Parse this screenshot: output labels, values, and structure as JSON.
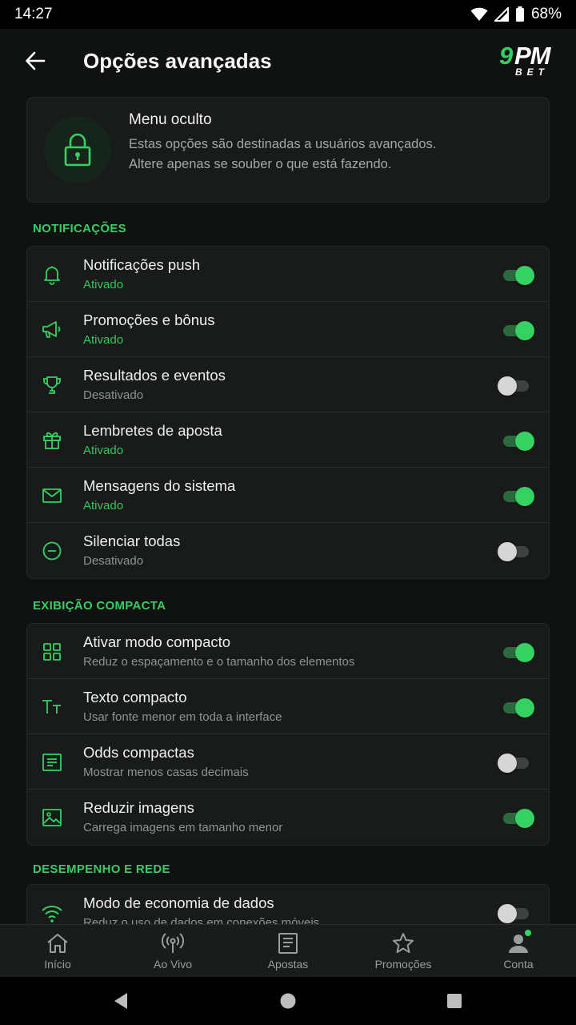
{
  "status": {
    "time": "14:27",
    "battery": "68%"
  },
  "appbar": {
    "title": "Opções avançadas",
    "logo_main_9": "9",
    "logo_main_pm": "PM",
    "logo_sub": "BET"
  },
  "hidden_menu": {
    "title": "Menu oculto",
    "description": "Estas opções são destinadas a usuários avançados. Altere apenas se souber o que está fazendo."
  },
  "sections": {
    "notifications": {
      "title": "NOTIFICAÇÕES",
      "items": [
        {
          "label": "Notificações push",
          "status": "Ativado",
          "on": true,
          "icon": "bell-icon"
        },
        {
          "label": "Promoções e bônus",
          "status": "Ativado",
          "on": true,
          "icon": "megaphone-icon"
        },
        {
          "label": "Resultados e eventos",
          "status": "Desativado",
          "on": false,
          "icon": "trophy-icon"
        },
        {
          "label": "Lembretes de aposta",
          "status": "Ativado",
          "on": true,
          "icon": "gift-icon"
        },
        {
          "label": "Mensagens do sistema",
          "status": "Ativado",
          "on": true,
          "icon": "mail-icon"
        },
        {
          "label": "Silenciar todas",
          "status": "Desativado",
          "on": false,
          "icon": "minus-circle-icon"
        }
      ]
    },
    "compact": {
      "title": "EXIBIÇÃO COMPACTA",
      "items": [
        {
          "label": "Ativar modo compacto",
          "desc": "Reduz o espaçamento e o tamanho dos elementos",
          "on": true,
          "icon": "grid-icon"
        },
        {
          "label": "Texto compacto",
          "desc": "Usar fonte menor em toda a interface",
          "on": true,
          "icon": "text-size-icon"
        },
        {
          "label": "Odds compactas",
          "desc": "Mostrar menos casas decimais",
          "on": false,
          "icon": "list-box-icon"
        },
        {
          "label": "Reduzir imagens",
          "desc": "Carrega imagens em tamanho menor",
          "on": true,
          "icon": "image-icon"
        }
      ]
    },
    "performance": {
      "title": "DESEMPENHO E REDE",
      "items": [
        {
          "label": "Modo de economia de dados",
          "desc": "Reduz o uso de dados em conexões móveis",
          "on": false,
          "icon": "wifi-icon"
        }
      ]
    }
  },
  "bottom_nav": [
    {
      "label": "Início",
      "icon": "home-icon"
    },
    {
      "label": "Ao Vivo",
      "icon": "broadcast-icon"
    },
    {
      "label": "Apostas",
      "icon": "betslip-icon"
    },
    {
      "label": "Promoções",
      "icon": "star-icon"
    },
    {
      "label": "Conta",
      "icon": "user-icon"
    }
  ],
  "colors": {
    "accent": "#35D162",
    "background": "#101111",
    "card": "#191B1A",
    "muted": "#8F9491"
  }
}
